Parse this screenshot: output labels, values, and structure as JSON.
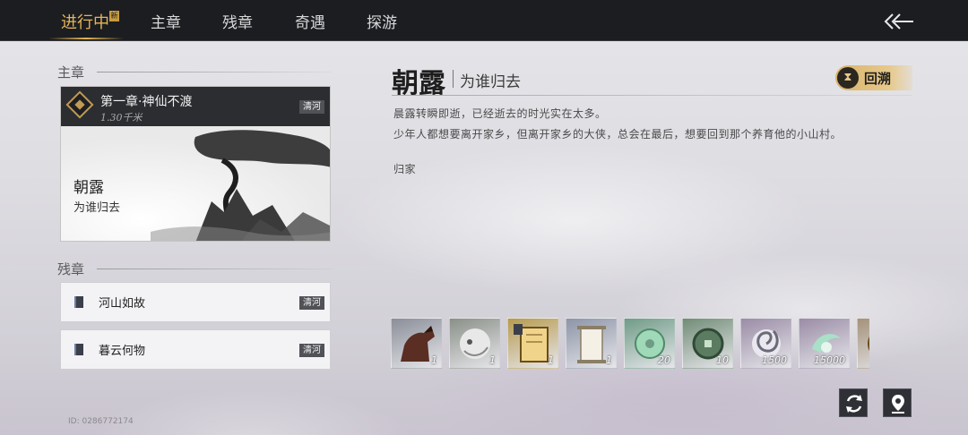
{
  "tabs": [
    {
      "label": "进行中",
      "active": true,
      "badge": "新"
    },
    {
      "label": "主章",
      "active": false
    },
    {
      "label": "残章",
      "active": false
    },
    {
      "label": "奇遇",
      "active": false
    },
    {
      "label": "探游",
      "active": false
    }
  ],
  "main_section": {
    "label": "主章",
    "card": {
      "chapter_title": "第一章·神仙不渡",
      "distance": "1.30千米",
      "tag": "清河",
      "big_title": "朝露",
      "small_title": "为谁归去"
    }
  },
  "side_section": {
    "label": "残章",
    "items": [
      {
        "label": "河山如故",
        "tag": "清河"
      },
      {
        "label": "暮云何物",
        "tag": "清河"
      }
    ]
  },
  "player_id": "ID: 0286772174",
  "detail": {
    "title": "朝露",
    "subtitle": "为谁归去",
    "recall_label": "回溯",
    "recall_icon": "hourglass-icon",
    "desc_lines": [
      "晨露转瞬即逝，已经逝去的时光实在太多。",
      "少年人都想要离开家乡，但离开家乡的大侠，总会在最后，想要回到那个养育他的小山村。"
    ],
    "objective": "归家"
  },
  "rewards": [
    {
      "name": "horse",
      "count": "1",
      "bg": "#8a8e98"
    },
    {
      "name": "white-mask",
      "count": "1",
      "bg": "#8a9088"
    },
    {
      "name": "golden-book",
      "count": "1",
      "bg": "#b69a4e"
    },
    {
      "name": "scroll",
      "count": "1",
      "bg": "#8c94a6"
    },
    {
      "name": "jade-coin",
      "count": "20",
      "bg": "#6f9b87"
    },
    {
      "name": "jade-disc",
      "count": "10",
      "bg": "#718c76"
    },
    {
      "name": "spiral-token",
      "count": "1500",
      "bg": "#9a8ca6"
    },
    {
      "name": "green-crescent",
      "count": "15000",
      "bg": "#9a8ca6"
    },
    {
      "name": "golden-orb",
      "count": "",
      "bg": "#a4927a"
    }
  ],
  "colors": {
    "accent": "#e6b556",
    "topbar": "#1b1d21",
    "tag_bg": "#505257"
  },
  "buttons": {
    "refresh_icon": "refresh-icon",
    "locate_icon": "map-pin-icon",
    "back_icon": "back-arrow-icon"
  }
}
